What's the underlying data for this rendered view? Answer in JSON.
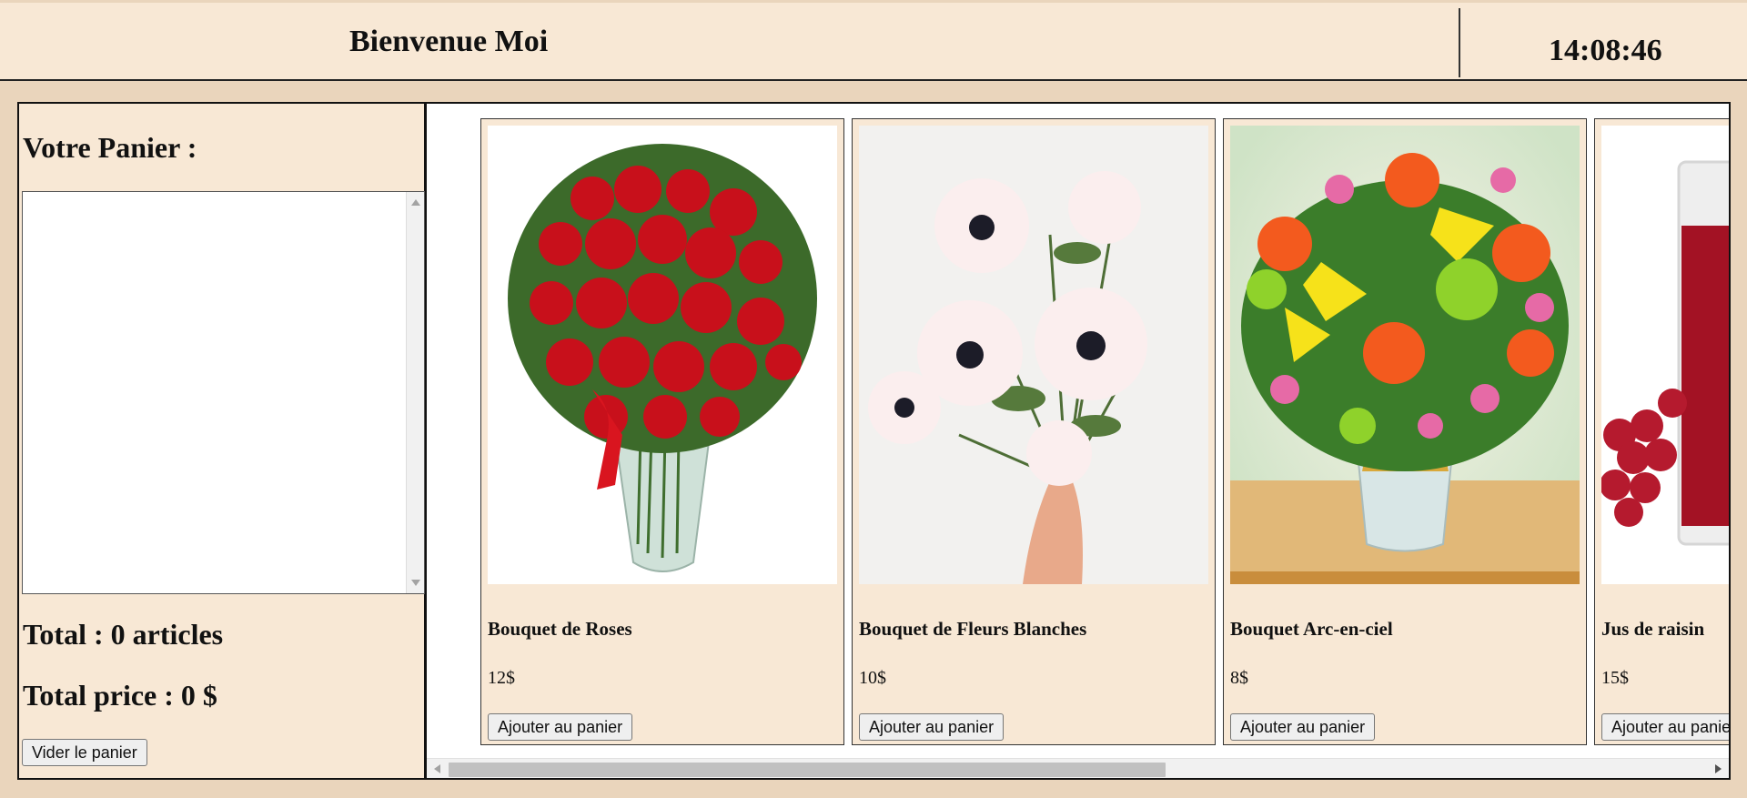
{
  "header": {
    "welcome": "Bienvenue Moi",
    "clock": "14:08:46"
  },
  "cart": {
    "title": "Votre Panier :",
    "total": "Total : 0 articles",
    "total_price": "Total price : 0 $",
    "empty_button": "Vider le panier",
    "items": []
  },
  "products": [
    {
      "name": "Bouquet de Roses",
      "price": "12$",
      "button": "Ajouter au panier",
      "image": "red-roses-bouquet"
    },
    {
      "name": "Bouquet de Fleurs Blanches",
      "price": "10$",
      "button": "Ajouter au panier",
      "image": "white-anemones-bouquet"
    },
    {
      "name": "Bouquet Arc-en-ciel",
      "price": "8$",
      "button": "Ajouter au panier",
      "image": "rainbow-bouquet"
    },
    {
      "name": "Jus de raisin",
      "price": "15$",
      "button": "Ajouter au panier",
      "image": "grape-juice"
    }
  ],
  "colors": {
    "page_background": "#ead5bc",
    "panel_background": "#f8e8d5"
  }
}
